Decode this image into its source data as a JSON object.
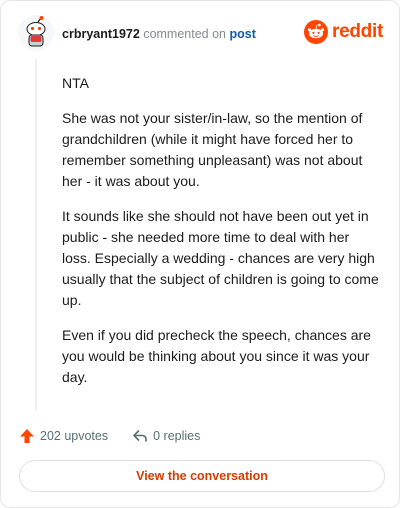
{
  "header": {
    "username": "crbryant1972",
    "action_text": "commented on",
    "post_link": "post",
    "brand": "reddit"
  },
  "icons": {
    "avatar": "snoo-avatar-icon",
    "brand_logo": "reddit-snoo-icon",
    "upvote": "upvote-arrow-icon",
    "reply": "reply-arrow-icon"
  },
  "colors": {
    "brand_orange": "#ff4500",
    "link_blue": "#0f5ba7",
    "cta_text": "#d93a00"
  },
  "comment": {
    "paragraphs": [
      "NTA",
      "She was not your sister/in-law, so the mention of grandchildren (while it might have forced her to remember something unpleasant) was not about her - it was about you.",
      "It sounds like she should not have been out yet in public - she needed more time to deal with her loss. Especially a wedding - chances are very high usually that the subject of children is going to come up.",
      "Even if you did precheck the speech, chances are you would be thinking about you since it was your day."
    ]
  },
  "actions": {
    "upvotes": "202 upvotes",
    "replies": "0 replies"
  },
  "cta": {
    "label": "View the conversation"
  }
}
